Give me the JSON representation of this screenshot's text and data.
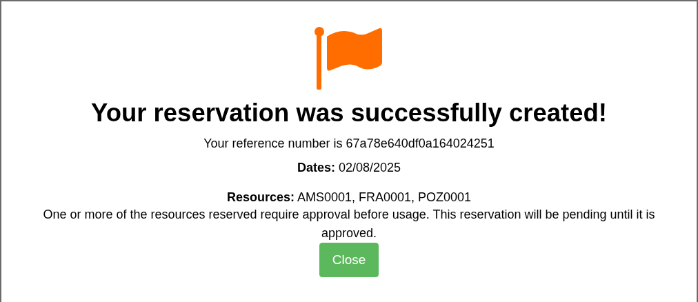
{
  "dialog": {
    "title": "Your reservation was successfully created!",
    "reference": "Your reference number is 67a78e640df0a164024251",
    "dates": "**Dates:** 02/08/2025",
    "resources": "**Resources:** AMS0001, FRA0001, POZ0001",
    "note": "One or more of the resources reserved require approval before usage. This reservation will be pending until it is approved.",
    "button": "Close"
  }
}
